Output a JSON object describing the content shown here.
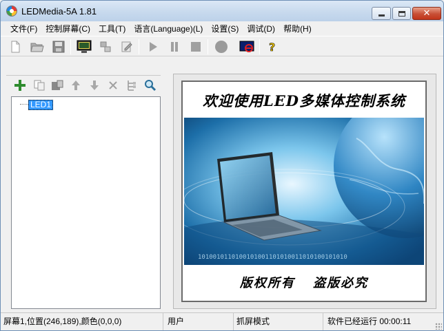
{
  "window": {
    "title": "LEDMedia-5A 1.81"
  },
  "menu": [
    "文件(F)",
    "控制屏幕(C)",
    "工具(T)",
    "语言(Language)(L)",
    "设置(S)",
    "调试(D)",
    "帮助(H)"
  ],
  "toolbar": {
    "icons": [
      "new-file-icon",
      "open-folder-icon",
      "save-icon",
      "monitor-icon",
      "network-icon",
      "edit-icon",
      "play-icon",
      "pause-icon",
      "stop-icon",
      "record-icon",
      "screen-off-icon",
      "help-icon"
    ]
  },
  "left_toolbar": {
    "icons": [
      "add-icon",
      "copy-icon",
      "paste-icon",
      "move-up-icon",
      "move-down-icon",
      "delete-icon",
      "tree-icon",
      "search-icon"
    ]
  },
  "tree": {
    "items": [
      "LED1"
    ]
  },
  "preview": {
    "headline": "欢迎使用LED多媒体控制系统",
    "footer": "版权所有 盗版必究",
    "binary": "1010010110100101001101010011010100101010"
  },
  "statusbar": {
    "screen_info": "屏幕1,位置(246,189),颜色(0,0,0)",
    "user": "用户",
    "mode": "抓屏模式",
    "runtime": "软件已经运行 00:00:11"
  },
  "colors": {
    "accent": "#3399ff",
    "title_bg": "#c9dbee",
    "close": "#c84f35"
  }
}
